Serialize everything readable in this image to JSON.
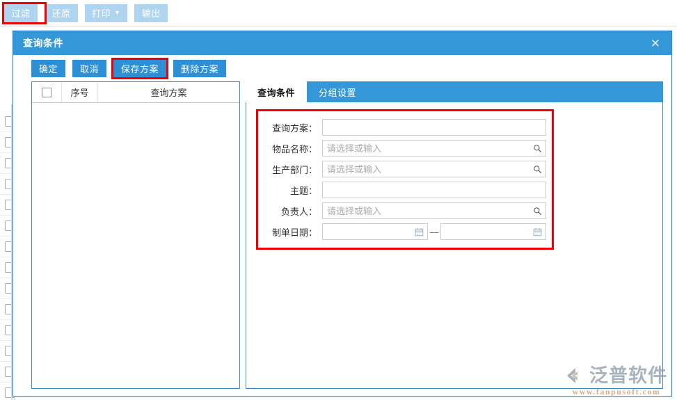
{
  "background_toolbar": {
    "buttons": [
      {
        "label": "过滤",
        "highlighted": true,
        "has_caret": false
      },
      {
        "label": "还原",
        "highlighted": false,
        "has_caret": false
      },
      {
        "label": "打印",
        "highlighted": false,
        "has_caret": true
      },
      {
        "label": "输出",
        "highlighted": false,
        "has_caret": false
      }
    ],
    "caret_glyph": "▼"
  },
  "dialog": {
    "title": "查询条件",
    "close_glyph": "✕",
    "actions": [
      {
        "label": "确定",
        "highlighted": false
      },
      {
        "label": "取消",
        "highlighted": false
      },
      {
        "label": "保存方案",
        "highlighted": true
      },
      {
        "label": "删除方案",
        "highlighted": false
      }
    ]
  },
  "scheme_list": {
    "columns": [
      "",
      "序号",
      "查询方案"
    ],
    "rows": []
  },
  "tabs": [
    {
      "label": "查询条件",
      "active": true
    },
    {
      "label": "分组设置",
      "active": false
    }
  ],
  "form": {
    "placeholder_select": "请选择或输入",
    "date_separator": "—",
    "fields": [
      {
        "label": "查询方案：",
        "value": "",
        "placeholder": "",
        "icon": "none"
      },
      {
        "label": "物品名称：",
        "value": "",
        "placeholder": "请选择或输入",
        "icon": "search-icon"
      },
      {
        "label": "生产部门：",
        "value": "",
        "placeholder": "请选择或输入",
        "icon": "search-icon"
      },
      {
        "label": "主题：",
        "value": "",
        "placeholder": "",
        "icon": "none"
      },
      {
        "label": "负责人：",
        "value": "",
        "placeholder": "请选择或输入",
        "icon": "search-icon"
      },
      {
        "label": "制单日期：",
        "value": "",
        "placeholder": "",
        "icon": "calendar-icon"
      }
    ],
    "date_field": {
      "label": "制单日期：",
      "start_value": "",
      "end_value": "",
      "icon": "calendar-icon"
    }
  },
  "watermark": {
    "text": "泛普软件",
    "url": "www.fanpusoft.com"
  },
  "colors": {
    "header_blue": "#3498d8",
    "button_blue": "#2d8fd5",
    "toolbar_button_blue": "#aed4ef",
    "highlight_red": "#ee0000",
    "border_blue": "#3a8dc4"
  }
}
